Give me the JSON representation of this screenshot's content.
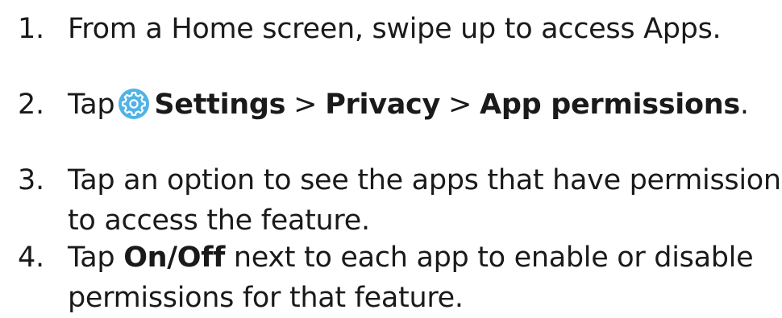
{
  "steps": [
    {
      "number": "1.",
      "text": "From a Home screen, swipe up to access Apps."
    },
    {
      "number": "2.",
      "tap": "Tap",
      "icon": "settings-gear-icon",
      "icon_color": "#4fb3e6",
      "settings": "Settings",
      "separator_1": ">",
      "privacy": "Privacy",
      "separator_2": ">",
      "app_permissions": "App permissions",
      "end": "."
    },
    {
      "number": "3.",
      "line1": "Tap an option to see the apps that have permission",
      "line2": "to access the feature."
    },
    {
      "number": "4.",
      "tap": "Tap",
      "on_off": "On/Off",
      "line1_rest": "next to each app to enable or disable",
      "line2": "permissions for that feature."
    }
  ]
}
